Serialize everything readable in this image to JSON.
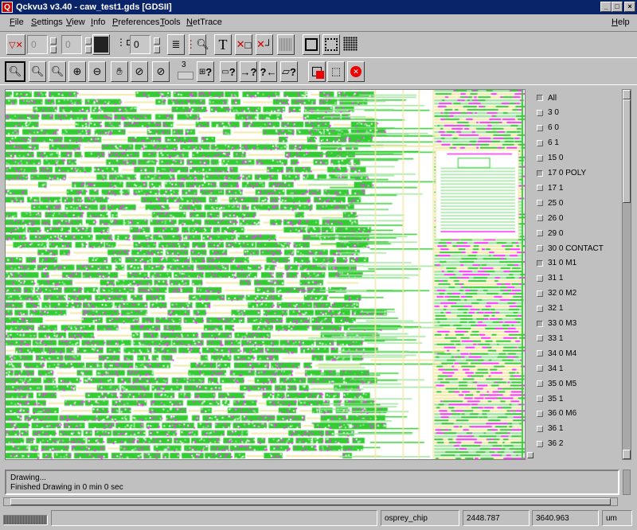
{
  "window": {
    "title": "Qckvu3 v3.40 - caw_test1.gds [GDSII]",
    "logo": "Q",
    "minimize": "_",
    "maximize": "□",
    "close": "×"
  },
  "menu": {
    "items": [
      "File",
      "Settings",
      "View",
      "Info",
      "Preferences",
      "Tools",
      "NetTrace"
    ],
    "help": "Help"
  },
  "toolbar1": {
    "field1": "0",
    "field2": "0",
    "field3": "0",
    "text_tool": "T"
  },
  "toolbar2": {
    "slider_value": "3",
    "query": "?"
  },
  "layers": [
    {
      "label": "All",
      "checked": true
    },
    {
      "label": "3 0",
      "checked": false
    },
    {
      "label": "6 0",
      "checked": false
    },
    {
      "label": "6 1",
      "checked": false
    },
    {
      "label": "15 0",
      "checked": false
    },
    {
      "label": "17 0 POLY",
      "checked": true
    },
    {
      "label": "17 1",
      "checked": false
    },
    {
      "label": "25 0",
      "checked": false
    },
    {
      "label": "26 0",
      "checked": false
    },
    {
      "label": "29 0",
      "checked": false
    },
    {
      "label": "30 0 CONTACT",
      "checked": false
    },
    {
      "label": "31 0 M1",
      "checked": true
    },
    {
      "label": "31 1",
      "checked": false
    },
    {
      "label": "32 0 M2",
      "checked": false
    },
    {
      "label": "32 1",
      "checked": false
    },
    {
      "label": "33 0 M3",
      "checked": true
    },
    {
      "label": "33 1",
      "checked": false
    },
    {
      "label": "34 0 M4",
      "checked": false
    },
    {
      "label": "34 1",
      "checked": false
    },
    {
      "label": "35 0 M5",
      "checked": false
    },
    {
      "label": "35 1",
      "checked": false
    },
    {
      "label": "36 0 M6",
      "checked": false
    },
    {
      "label": "36 1",
      "checked": false
    },
    {
      "label": "36 2",
      "checked": false
    }
  ],
  "messages": [
    "Drawing...",
    "Finished Drawing in 0 min 0 sec"
  ],
  "status": {
    "cell": "osprey_chip",
    "x": "2448.787",
    "y": "3640.963",
    "units": "um"
  },
  "colors": {
    "green": "#33cc33",
    "magenta": "#ff33ff",
    "yellow": "#f3eaa8",
    "light_green": "#9fe59f",
    "title_bar": "#0a246a"
  }
}
